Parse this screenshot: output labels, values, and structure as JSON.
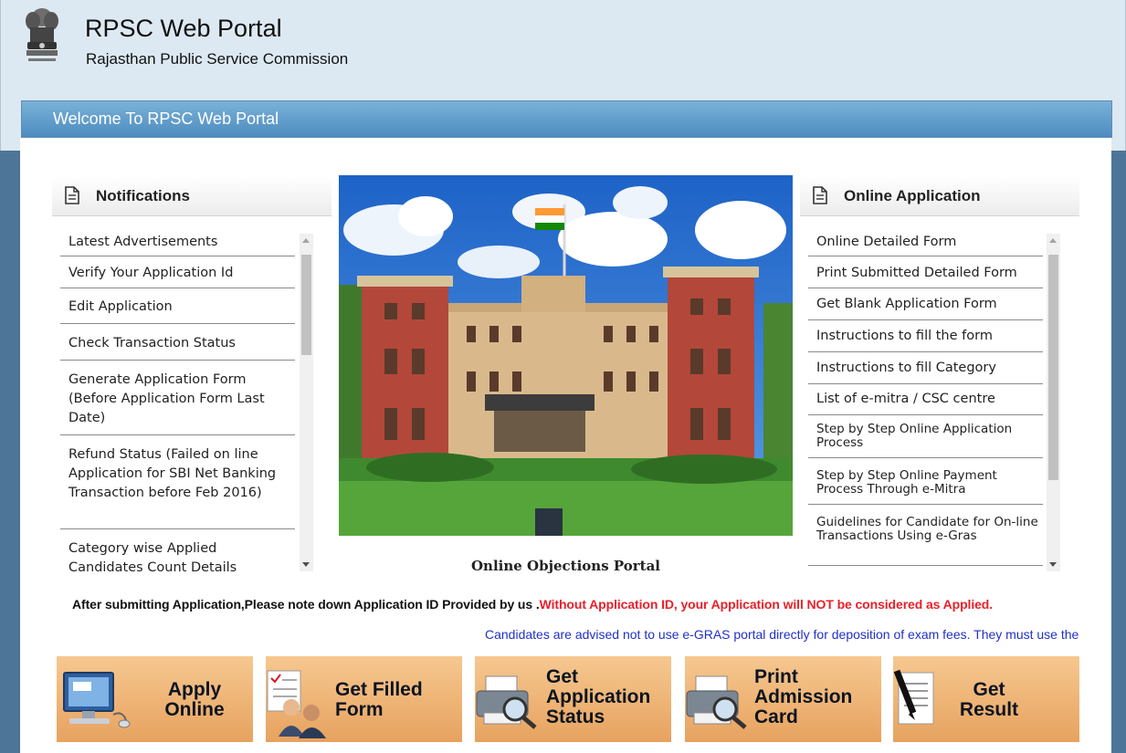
{
  "header": {
    "title": "RPSC Web Portal",
    "subtitle": "Rajasthan Public Service Commission",
    "welcome": "Welcome To RPSC Web Portal"
  },
  "notifications": {
    "heading": "Notifications",
    "items": [
      "Latest Advertisements",
      "Verify Your Application Id",
      "Edit Application",
      "Check Transaction Status",
      "Generate Application Form (Before Application Form Last Date)",
      "Refund Status (Failed on line Application for SBI Net Banking Transaction before Feb 2016)",
      "Category wise Applied Candidates Count Details"
    ]
  },
  "online_application": {
    "heading": "Online Application",
    "items": [
      "Online Detailed Form",
      "Print Submitted Detailed Form",
      "Get Blank Application Form",
      "Instructions to fill the form",
      "Instructions to fill Category",
      "List of e-mitra / CSC centre",
      "Step by Step Online Application Process",
      "Step by Step Online Payment Process Through e-Mitra",
      "Guidelines for Candidate for On-line Transactions Using e-Gras"
    ]
  },
  "banner": {
    "caption": "Online Objections Portal"
  },
  "notice": {
    "black": "After submitting Application,Please note down Application ID Provided by us .",
    "red": "Without Application ID, your Application will NOT be considered as Applied."
  },
  "marquee": "Candidates are advised not to use e-GRAS portal directly for deposition of exam fees. They must use the payment option given in the portal.",
  "tiles": {
    "apply": [
      "Apply",
      "Online"
    ],
    "filled": [
      "Get Filled",
      "Form"
    ],
    "status": [
      "Get",
      "Application",
      "Status"
    ],
    "admit": [
      "Print",
      "Admission",
      "Card"
    ],
    "result": [
      "Get",
      "Result"
    ]
  },
  "colors": {
    "header_bg": "#dde9f2",
    "welcome_bar": "#5b9acb",
    "side_dark": "#4d7597",
    "tile_orange": "#eeb272",
    "notice_red": "#e8202a",
    "marquee_blue": "#2030c8"
  }
}
